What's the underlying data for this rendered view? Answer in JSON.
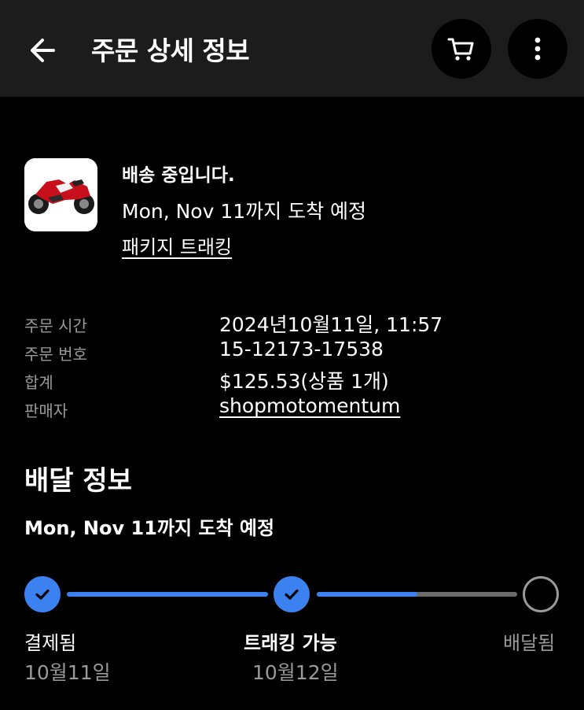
{
  "header": {
    "title": "주문 상세 정보",
    "back_icon": "arrow-left-icon",
    "cart_icon": "cart-icon",
    "more_icon": "more-vertical-icon"
  },
  "shipment": {
    "status": "배송 중입니다.",
    "eta": "Mon, Nov 11까지 도착 예정",
    "track_link": "패키지 트래킹",
    "thumbnail_icon": "motorcycle-image"
  },
  "order_info": [
    {
      "label": "주문 시간",
      "value": "2024년10월11일, 11:57"
    },
    {
      "label": "주문 번호",
      "value": "15-12173-17538"
    },
    {
      "label": "합계",
      "value": "$125.53(상품 1개)"
    },
    {
      "label": "판매자",
      "value": "shopmotomentum"
    }
  ],
  "delivery": {
    "title": "배달 정보",
    "eta": "Mon, Nov 11까지 도착 예정",
    "progress": 0.75,
    "steps": [
      {
        "label": "결제됨",
        "date": "10월11일",
        "state": "done"
      },
      {
        "label": "트래킹 가능",
        "date": "10월12일",
        "state": "done"
      },
      {
        "label": "배달됨",
        "date": "",
        "state": "pending"
      }
    ]
  },
  "colors": {
    "background": "#000000",
    "header_bg": "#1c1c1c",
    "accent_blue": "#3b82f0",
    "muted_text": "#9a9a9a",
    "track_gray": "#6b6b6b"
  }
}
